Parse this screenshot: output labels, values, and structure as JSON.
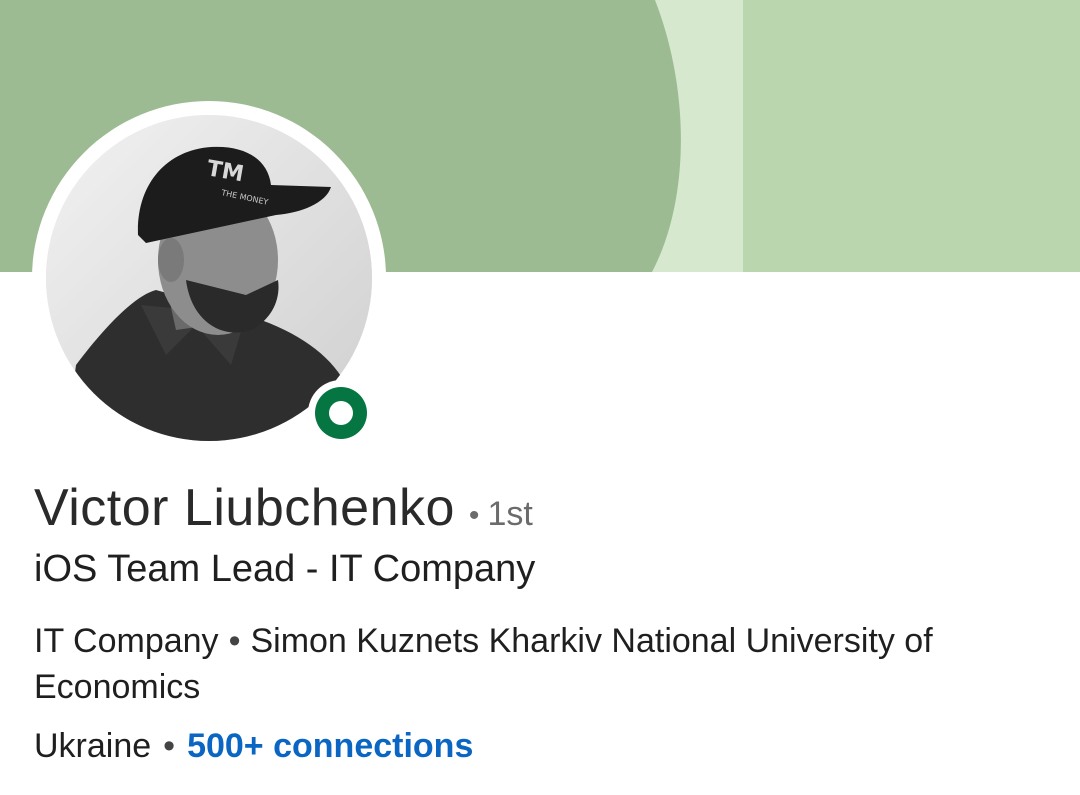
{
  "profile": {
    "name": "Victor Liubchenko",
    "bullet": "•",
    "degree": "1st",
    "headline": "iOS Team Lead - IT Company",
    "company": "IT Company",
    "education": "Simon  Kuznets Kharkiv National University of Economics",
    "location": "Ukraine",
    "connections": "500+ connections",
    "photo": {
      "cap_text": "TM",
      "cap_subtext": "THE MONEY"
    }
  },
  "colors": {
    "banner_dark": "#9dbb92",
    "banner_light_stripe": "#d6e9cf",
    "banner_right": "#b9d6ae",
    "presence": "#057642",
    "link": "#0a66c2"
  },
  "icons": {
    "presence": "online-status-icon"
  }
}
